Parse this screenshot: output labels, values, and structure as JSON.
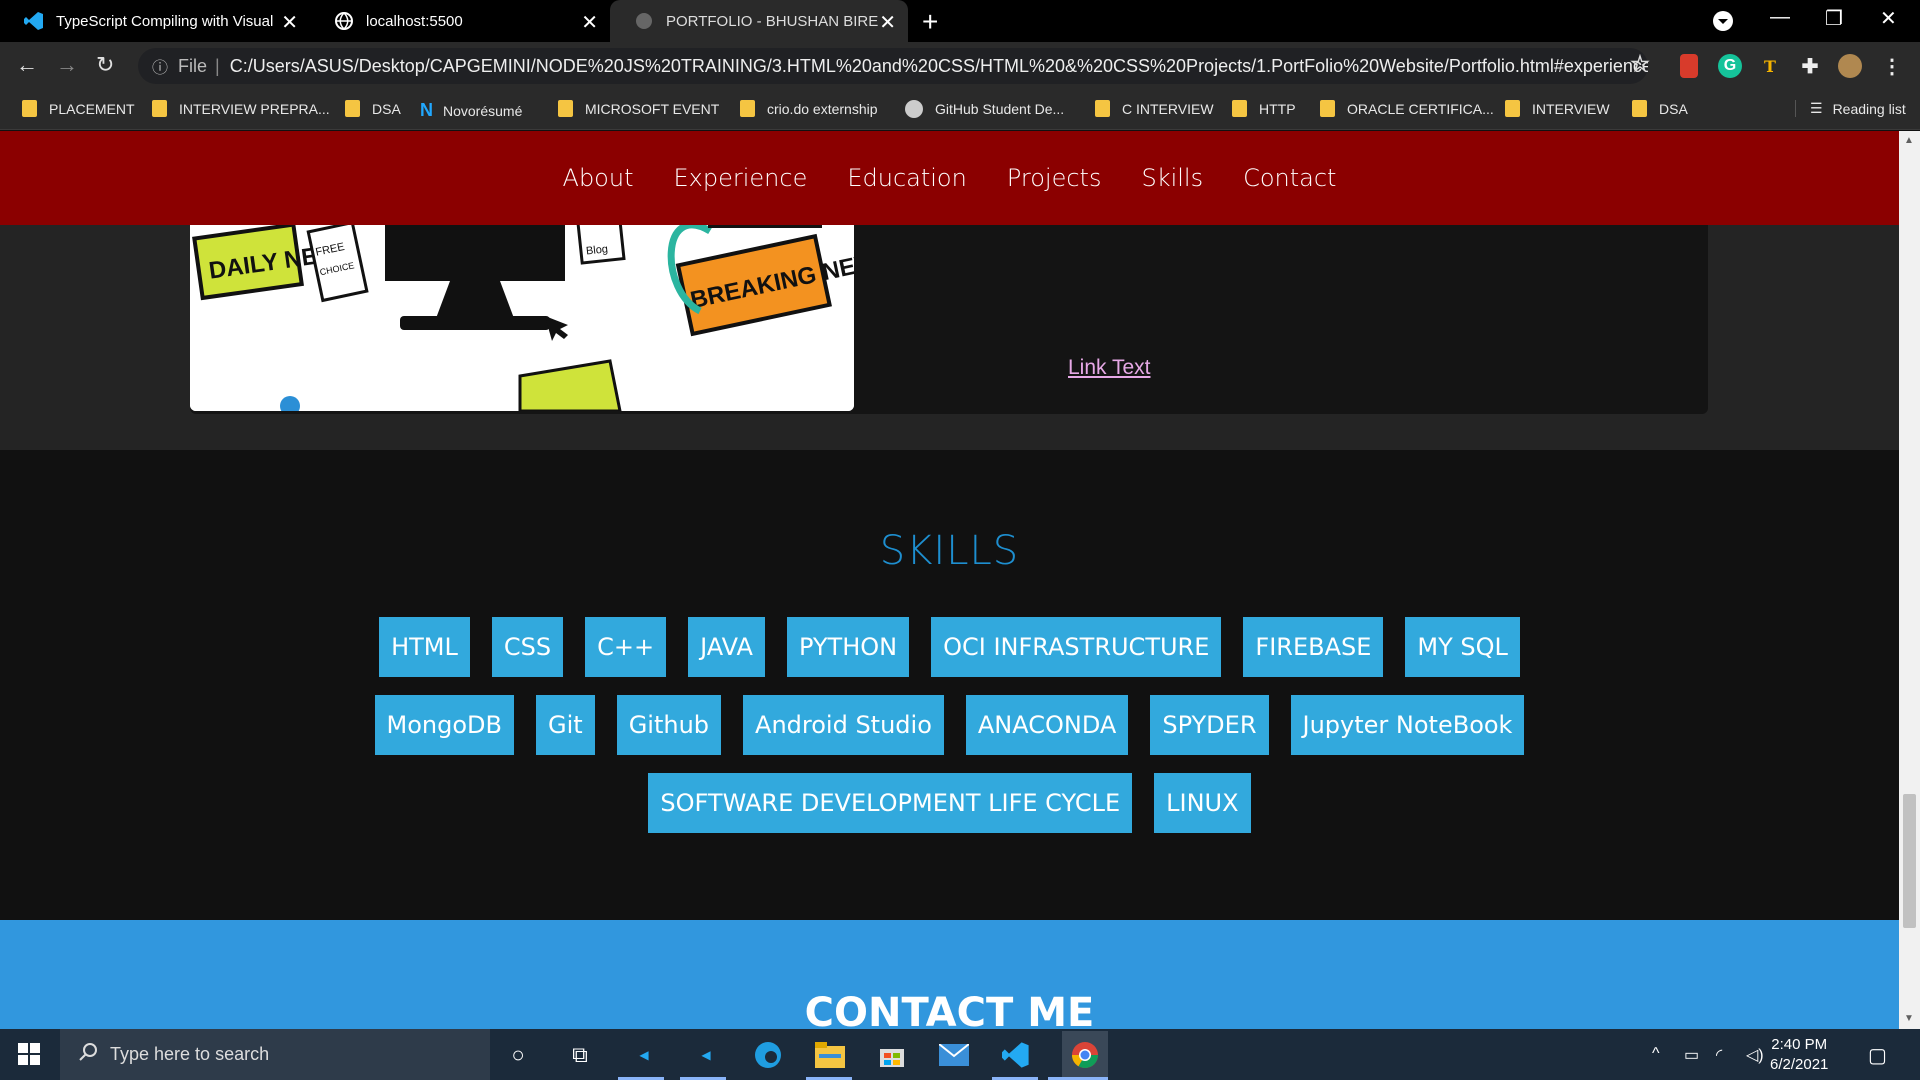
{
  "browser": {
    "tabs": [
      {
        "title": "TypeScript Compiling with Visual",
        "icon": "vscode-icon"
      },
      {
        "title": "localhost:5500",
        "icon": "globe-icon"
      },
      {
        "title": "PORTFOLIO - BHUSHAN BIRE",
        "icon": "page-icon"
      }
    ],
    "address": {
      "scheme_label": "File",
      "url": "C:/Users/ASUS/Desktop/CAPGEMINI/NODE%20JS%20TRAINING/3.HTML%20and%20CSS/HTML%20&%20CSS%20Projects/1.PortFolio%20Website/Portfolio.html#experience"
    },
    "bookmarks": [
      {
        "label": "PLACEMENT",
        "icon": "folder-icon"
      },
      {
        "label": "INTERVIEW PREPRA...",
        "icon": "folder-icon"
      },
      {
        "label": "DSA",
        "icon": "folder-icon"
      },
      {
        "label": "Novorésumé",
        "icon": "novoresume-icon"
      },
      {
        "label": "MICROSOFT EVENT",
        "icon": "folder-icon"
      },
      {
        "label": "crio.do externship",
        "icon": "folder-icon"
      },
      {
        "label": "GitHub Student De...",
        "icon": "github-icon"
      },
      {
        "label": "C INTERVIEW",
        "icon": "folder-icon"
      },
      {
        "label": "HTTP",
        "icon": "folder-icon"
      },
      {
        "label": "ORACLE CERTIFICA...",
        "icon": "folder-icon"
      },
      {
        "label": "INTERVIEW",
        "icon": "folder-icon"
      },
      {
        "label": "DSA",
        "icon": "folder-icon"
      }
    ],
    "reading_list": "Reading list"
  },
  "site": {
    "nav": [
      "About",
      "Experience",
      "Education",
      "Projects",
      "Skills",
      "Contact"
    ],
    "project": {
      "link_text": "Link Text",
      "image_words": [
        "DAILY NEWS",
        "FREE",
        "CHOICE",
        "BREAKING NEWS",
        "Blog"
      ]
    },
    "skills": {
      "title": "SKILLS",
      "rows": [
        [
          "HTML",
          "CSS",
          "C++",
          "JAVA",
          "PYTHON",
          "OCI INFRASTRUCTURE",
          "FIREBASE",
          "MY SQL"
        ],
        [
          "MongoDB",
          "Git",
          "Github",
          "Android Studio",
          "ANACONDA",
          "SPYDER",
          "Jupyter NoteBook"
        ],
        [
          "SOFTWARE DEVELOPMENT LIFE CYCLE",
          "LINUX"
        ]
      ]
    },
    "contact": {
      "title": "CONTACT ME"
    },
    "colors": {
      "nav_bg": "#8b0000",
      "skill_bg": "#32a9dd",
      "skills_title": "#1e8fd0",
      "contact_bg": "#3197de"
    }
  },
  "taskbar": {
    "search_placeholder": "Type here to search",
    "time": "2:40 PM",
    "date": "6/2/2021"
  }
}
